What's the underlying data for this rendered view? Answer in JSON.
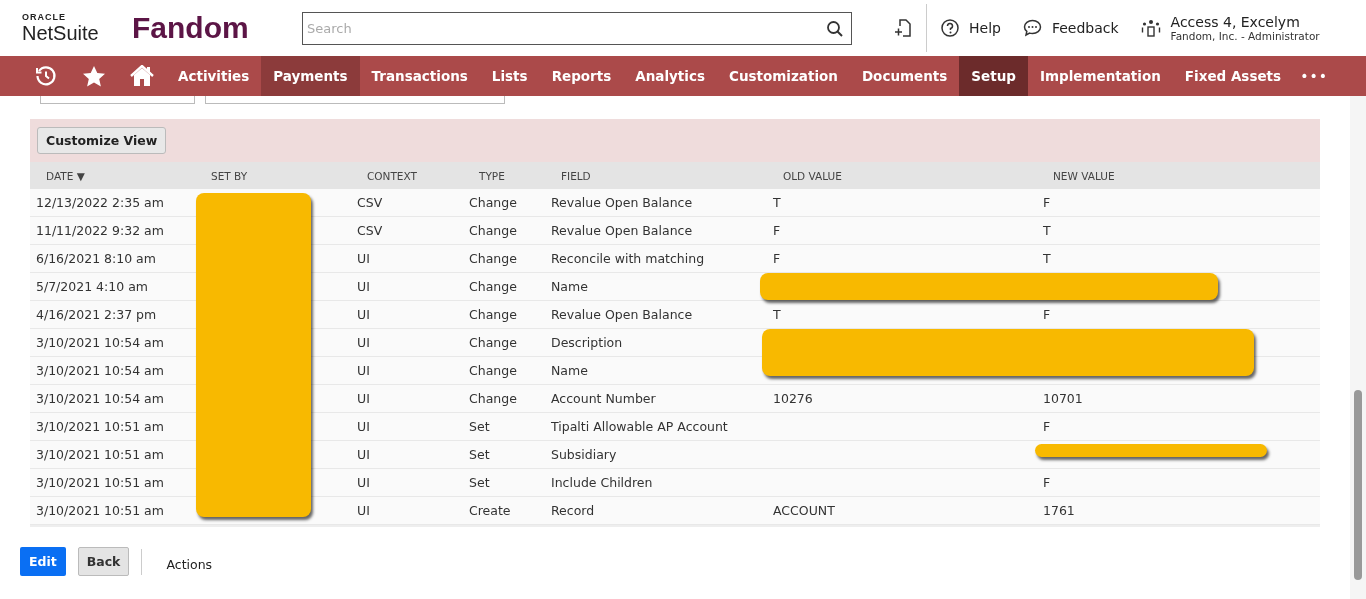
{
  "header": {
    "logo_top": "ORACLE",
    "logo_bottom": "NetSuite",
    "brand": "Fandom",
    "search": {
      "placeholder": "Search"
    },
    "help": "Help",
    "feedback": "Feedback",
    "user": {
      "name": "Access 4, Excelym",
      "role": "Fandom, Inc. - Administrator"
    }
  },
  "nav": {
    "items": [
      {
        "label": "Activities",
        "selected": false,
        "hover": false
      },
      {
        "label": "Payments",
        "selected": false,
        "hover": true
      },
      {
        "label": "Transactions",
        "selected": false,
        "hover": false
      },
      {
        "label": "Lists",
        "selected": false,
        "hover": false
      },
      {
        "label": "Reports",
        "selected": false,
        "hover": false
      },
      {
        "label": "Analytics",
        "selected": false,
        "hover": false
      },
      {
        "label": "Customization",
        "selected": false,
        "hover": false
      },
      {
        "label": "Documents",
        "selected": false,
        "hover": false
      },
      {
        "label": "Setup",
        "selected": true,
        "hover": false
      },
      {
        "label": "Implementation",
        "selected": false,
        "hover": false
      },
      {
        "label": "Fixed Assets",
        "selected": false,
        "hover": false
      }
    ],
    "more": "•••"
  },
  "toolbar": {
    "button": "Customize View"
  },
  "table": {
    "columns": [
      "DATE",
      "SET BY",
      "CONTEXT",
      "TYPE",
      "FIELD",
      "OLD VALUE",
      "NEW VALUE"
    ],
    "sort_mark": "▼",
    "rows": [
      [
        "12/13/2022 2:35 am",
        "",
        "CSV",
        "Change",
        "Revalue Open Balance",
        "T",
        "F"
      ],
      [
        "11/11/2022 9:32 am",
        "",
        "CSV",
        "Change",
        "Revalue Open Balance",
        "F",
        "T"
      ],
      [
        "6/16/2021 8:10 am",
        "",
        "UI",
        "Change",
        "Reconcile with matching",
        "F",
        "T"
      ],
      [
        "5/7/2021 4:10 am",
        "",
        "UI",
        "Change",
        "Name",
        "",
        ""
      ],
      [
        "4/16/2021 2:37 pm",
        "",
        "UI",
        "Change",
        "Revalue Open Balance",
        "T",
        "F"
      ],
      [
        "3/10/2021 10:54 am",
        "",
        "UI",
        "Change",
        "Description",
        "",
        ""
      ],
      [
        "3/10/2021 10:54 am",
        "",
        "UI",
        "Change",
        "Name",
        "",
        ""
      ],
      [
        "3/10/2021 10:54 am",
        "",
        "UI",
        "Change",
        "Account Number",
        "10276",
        "10701"
      ],
      [
        "3/10/2021 10:51 am",
        "",
        "UI",
        "Set",
        "Tipalti Allowable AP Account",
        "",
        "F"
      ],
      [
        "3/10/2021 10:51 am",
        "",
        "UI",
        "Set",
        "Subsidiary",
        "",
        ""
      ],
      [
        "3/10/2021 10:51 am",
        "",
        "UI",
        "Set",
        "Include Children",
        "",
        "F"
      ],
      [
        "3/10/2021 10:51 am",
        "",
        "UI",
        "Create",
        "Record",
        "ACCOUNT",
        "1761"
      ]
    ]
  },
  "footer": {
    "edit": "Edit",
    "back": "Back",
    "actions": "Actions"
  }
}
